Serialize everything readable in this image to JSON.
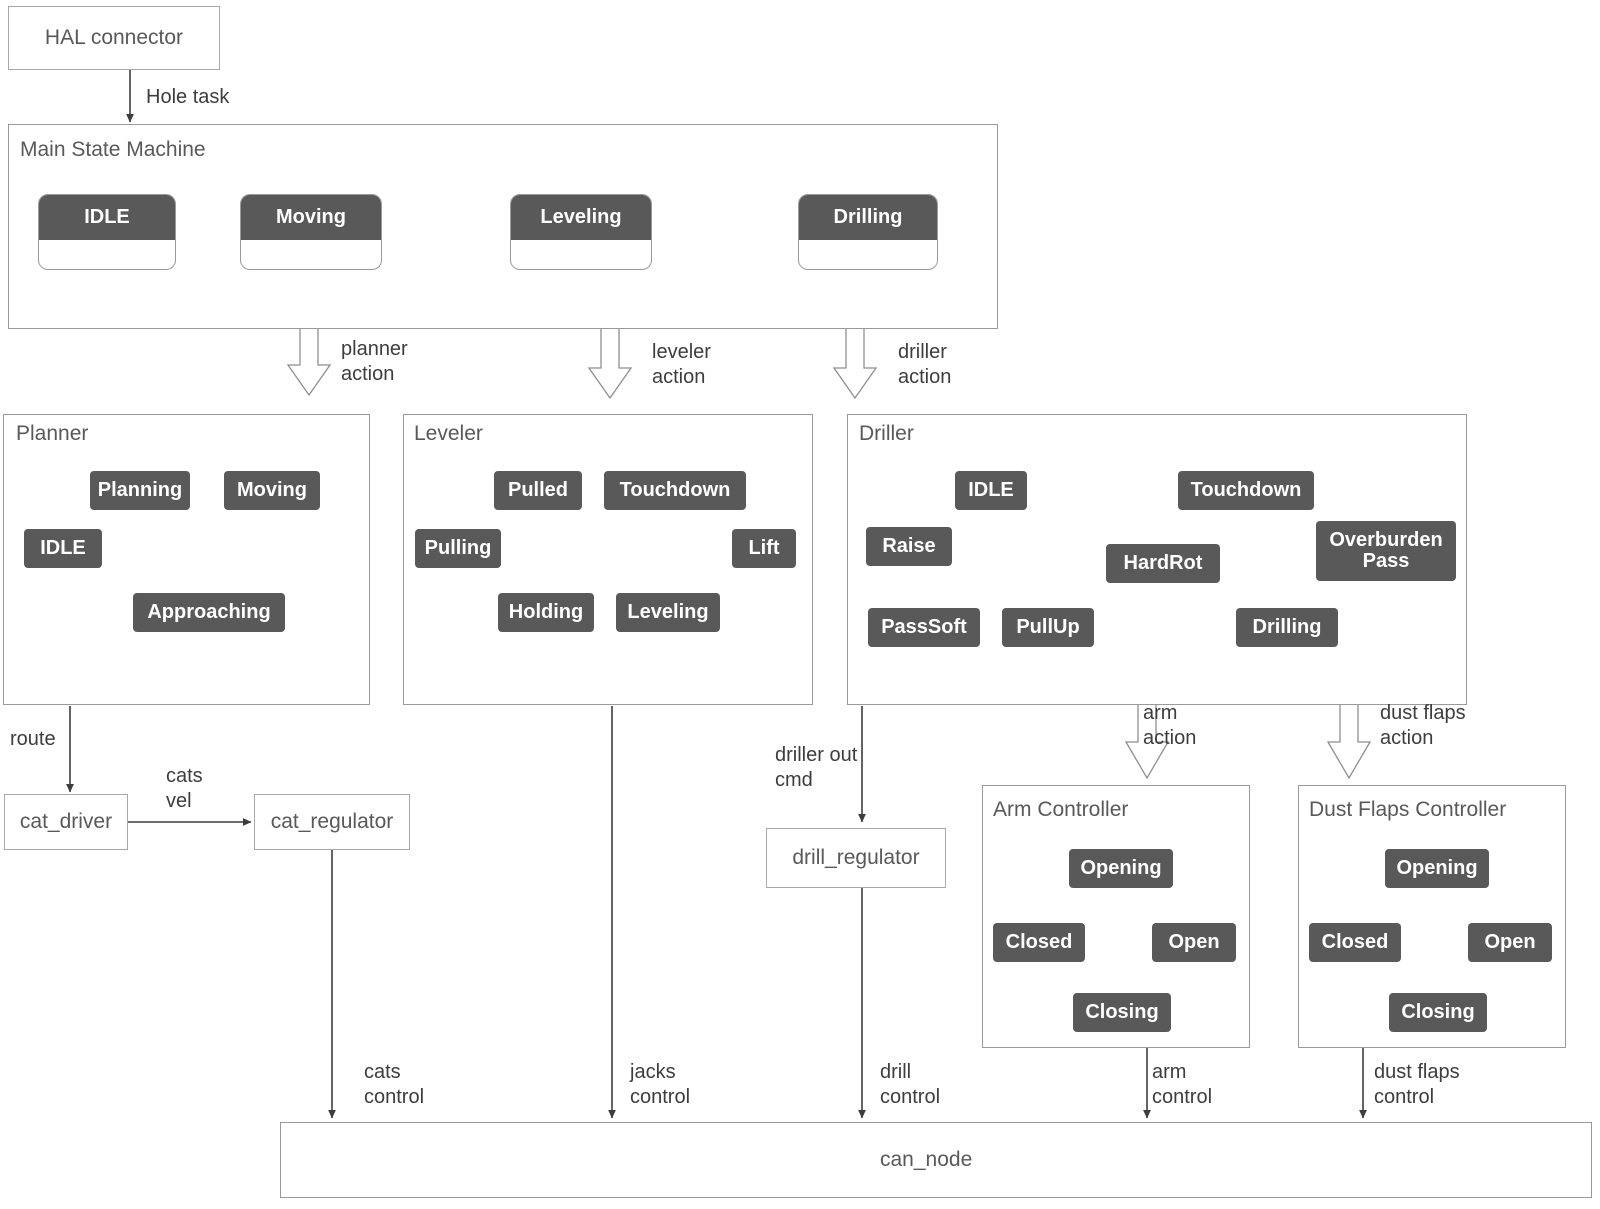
{
  "diagram": {
    "title": "Drilling rig control architecture state machine diagram",
    "colors": {
      "state_fill": "#595959",
      "state_text": "#ffffff",
      "container_border": "#9a9a9a",
      "edge": "#5a5a5a",
      "background": "#ffffff"
    }
  },
  "hal": {
    "label": "HAL connector"
  },
  "main_state_machine": {
    "title": "Main State Machine",
    "states": [
      {
        "label": "IDLE"
      },
      {
        "label": "Moving"
      },
      {
        "label": "Leveling"
      },
      {
        "label": "Drilling"
      }
    ]
  },
  "planner": {
    "title": "Planner",
    "states": [
      {
        "label": "Planning"
      },
      {
        "label": "Moving"
      },
      {
        "label": "IDLE"
      },
      {
        "label": "Approaching"
      }
    ]
  },
  "leveler": {
    "title": "Leveler",
    "states": [
      {
        "label": "Pulled"
      },
      {
        "label": "Touchdown"
      },
      {
        "label": "Pulling"
      },
      {
        "label": "Lift"
      },
      {
        "label": "Holding"
      },
      {
        "label": "Leveling"
      }
    ]
  },
  "driller": {
    "title": "Driller",
    "states": [
      {
        "label": "IDLE"
      },
      {
        "label": "Touchdown"
      },
      {
        "label": "Raise"
      },
      {
        "label": "HardRot"
      },
      {
        "label": "Overburden Pass"
      },
      {
        "label": "PassSoft"
      },
      {
        "label": "PullUp"
      },
      {
        "label": "Drilling"
      }
    ]
  },
  "arm_controller": {
    "title": "Arm Controller",
    "states": [
      {
        "label": "Opening"
      },
      {
        "label": "Closed"
      },
      {
        "label": "Open"
      },
      {
        "label": "Closing"
      }
    ]
  },
  "dust_flaps_controller": {
    "title": "Dust Flaps Controller",
    "states": [
      {
        "label": "Opening"
      },
      {
        "label": "Closed"
      },
      {
        "label": "Open"
      },
      {
        "label": "Closing"
      }
    ]
  },
  "nodes": {
    "cat_driver": "cat_driver",
    "cat_regulator": "cat_regulator",
    "drill_regulator": "drill_regulator",
    "can_node": "can_node"
  },
  "edge_labels": {
    "hole_task": "Hole task",
    "planner_action": "planner\naction",
    "leveler_action": "leveler\naction",
    "driller_action": "driller\naction",
    "arm_action": "arm\naction",
    "dust_flaps_action": "dust flaps\naction",
    "route": "route",
    "cats_vel": "cats\nvel",
    "driller_out_cmd": "driller out\ncmd",
    "cats_control": "cats\ncontrol",
    "jacks_control": "jacks\ncontrol",
    "drill_control": "drill\ncontrol",
    "arm_control": "arm\ncontrol",
    "dust_flaps_control": "dust flaps\ncontrol"
  }
}
